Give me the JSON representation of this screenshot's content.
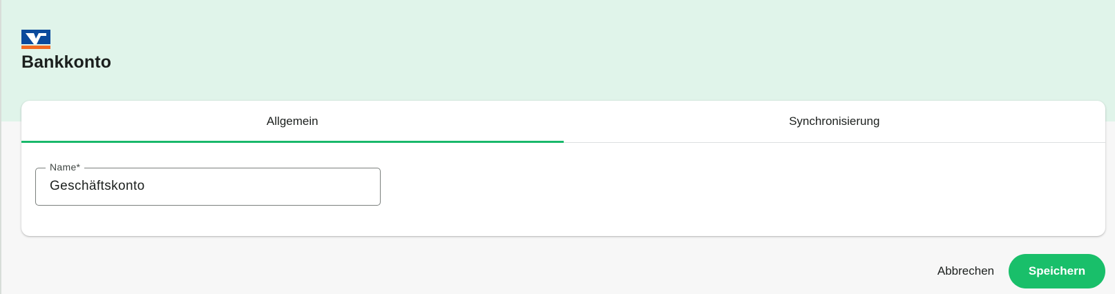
{
  "header": {
    "logo_icon": "volksbank-logo-icon",
    "title": "Bankkonto",
    "background_color": "#e0f4ea"
  },
  "tabs": [
    {
      "label": "Allgemein",
      "active": true
    },
    {
      "label": "Synchronisierung",
      "active": false
    }
  ],
  "form": {
    "name_field": {
      "label": "Name*",
      "value": "Geschäftskonto"
    }
  },
  "actions": {
    "cancel_label": "Abbrechen",
    "save_label": "Speichern"
  },
  "colors": {
    "accent": "#19bf6a",
    "logo_blue": "#0a4a9c",
    "logo_orange": "#f26a21"
  }
}
